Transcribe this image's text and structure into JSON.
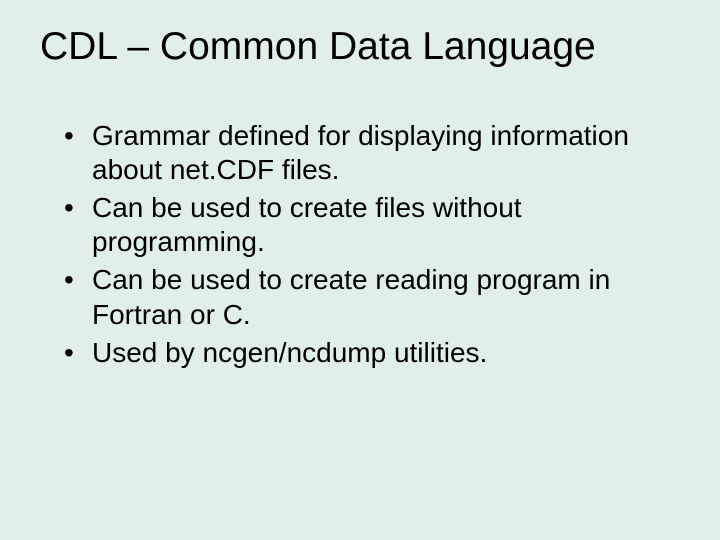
{
  "title": "CDL – Common Data Language",
  "bullets": [
    "Grammar defined for displaying information about net.CDF files.",
    "Can be used to create files without programming.",
    "Can be used to create reading program in Fortran or C.",
    "Used by ncgen/ncdump utilities."
  ]
}
